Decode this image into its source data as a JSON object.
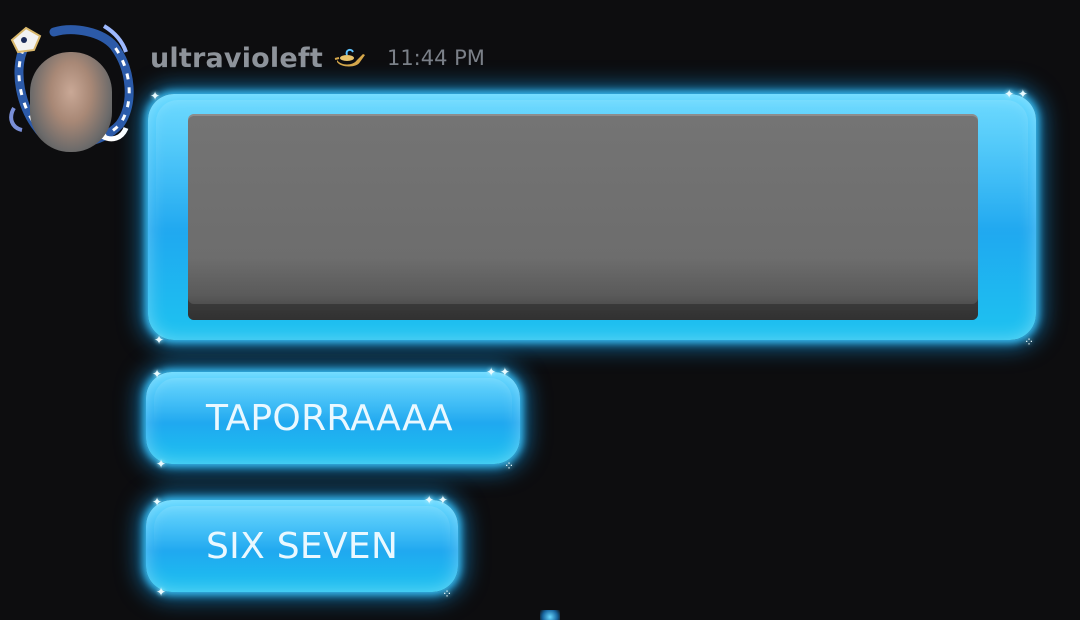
{
  "message": {
    "author": {
      "username": "ultravioleft",
      "badge_icon": "magic-lamp-icon"
    },
    "timestamp": "11:44 PM",
    "attachment": {
      "type": "image",
      "description_visible": false
    },
    "lines": [
      {
        "text": "TAPORRAAAA"
      },
      {
        "text": "SIX SEVEN"
      }
    ]
  },
  "theme": {
    "background": "#0d0d0f",
    "bubble_glow": "#1fb6ff",
    "username_color": "#8e939a",
    "text_color": "#eaf8ff"
  }
}
